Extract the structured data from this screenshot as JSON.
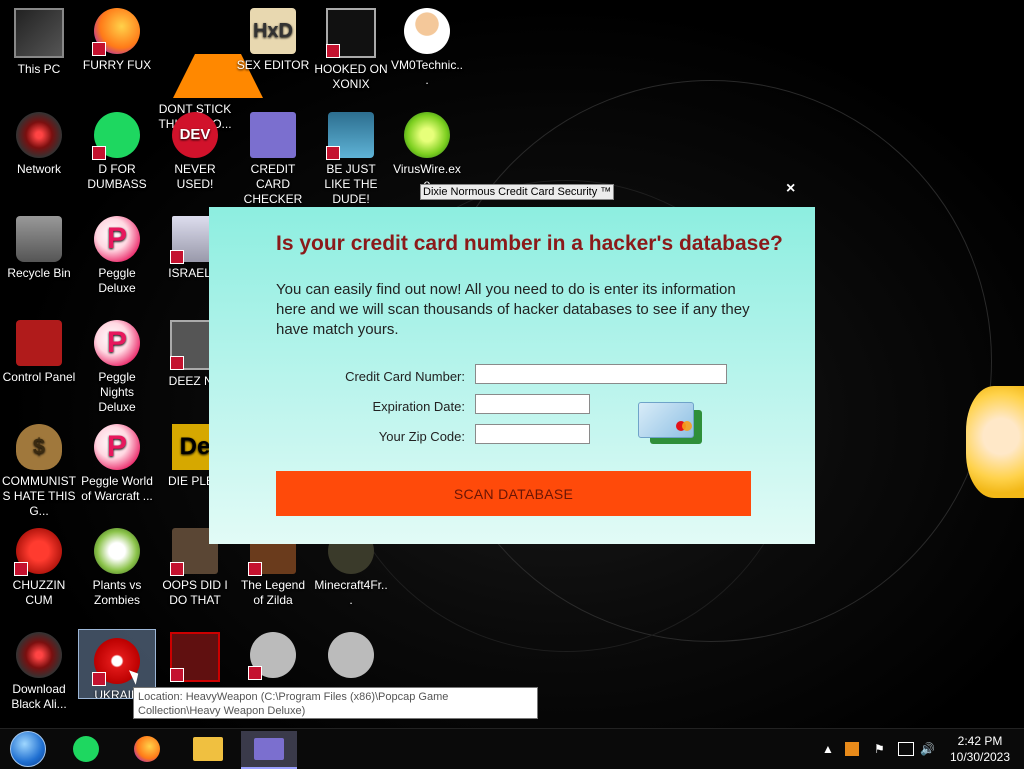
{
  "desktop": {
    "icons": [
      {
        "label": "This PC"
      },
      {
        "label": "FURRY FUX"
      },
      {
        "label": "DONT STICK THIS IN YO..."
      },
      {
        "label": "SEX EDITOR"
      },
      {
        "label": "HOOKED ON XONIX"
      },
      {
        "label": "VM0Technic..."
      },
      {
        "label": "Network"
      },
      {
        "label": "D FOR DUMBASS"
      },
      {
        "label": "NEVER USED!"
      },
      {
        "label": "CREDIT CARD CHECKER"
      },
      {
        "label": "BE JUST LIKE THE DUDE!"
      },
      {
        "label": "VirusWire.exe"
      },
      {
        "label": "Recycle Bin"
      },
      {
        "label": "Peggle Deluxe"
      },
      {
        "label": "ISRAEL S"
      },
      {
        "label": "Control Panel"
      },
      {
        "label": "Peggle Nights Deluxe"
      },
      {
        "label": "DEEZ NU"
      },
      {
        "label": "COMMUNISTS HATE THIS G..."
      },
      {
        "label": "Peggle World of Warcraft ..."
      },
      {
        "label": "DIE PLEA"
      },
      {
        "label": "CHUZZIN CUM"
      },
      {
        "label": "Plants vs Zombies"
      },
      {
        "label": "OOPS DID I DO THAT"
      },
      {
        "label": "The Legend of Zilda"
      },
      {
        "label": "Minecraft4Fr..."
      },
      {
        "label": "Download Black Ali..."
      },
      {
        "label": "UKRAIN"
      }
    ],
    "dev_icon_text": "DEV",
    "peggle_letter": "P",
    "hxd_text": "HxD",
    "bag_symbol": "$",
    "die_text": "De"
  },
  "popup": {
    "title": "Dixie Normous Credit Card Security ™",
    "close_glyph": "×",
    "heading": "Is your credit card number in a hacker's database?",
    "description": "You can easily find out now! All you need to do is enter its information here and we will scan thousands of hacker databases to see if any they have match yours.",
    "fields": {
      "card_number_label": "Credit Card Number:",
      "card_number_value": "",
      "expiration_label": "Expiration Date:",
      "expiration_value": "",
      "zip_label": "Your Zip Code:",
      "zip_value": ""
    },
    "scan_button": "SCAN DATABASE",
    "colors": {
      "heading": "#8b1a1a",
      "button": "#ff4a0a"
    }
  },
  "tooltip": {
    "text": "Location: HeavyWeapon (C:\\Program Files (x86)\\Popcap Game Collection\\Heavy Weapon Deluxe)"
  },
  "taskbar": {
    "tray": {
      "up_arrow": "▲",
      "flag_glyph": "⚑",
      "volume_glyph": "🔊"
    },
    "clock": {
      "time": "2:42 PM",
      "date": "10/30/2023"
    }
  }
}
